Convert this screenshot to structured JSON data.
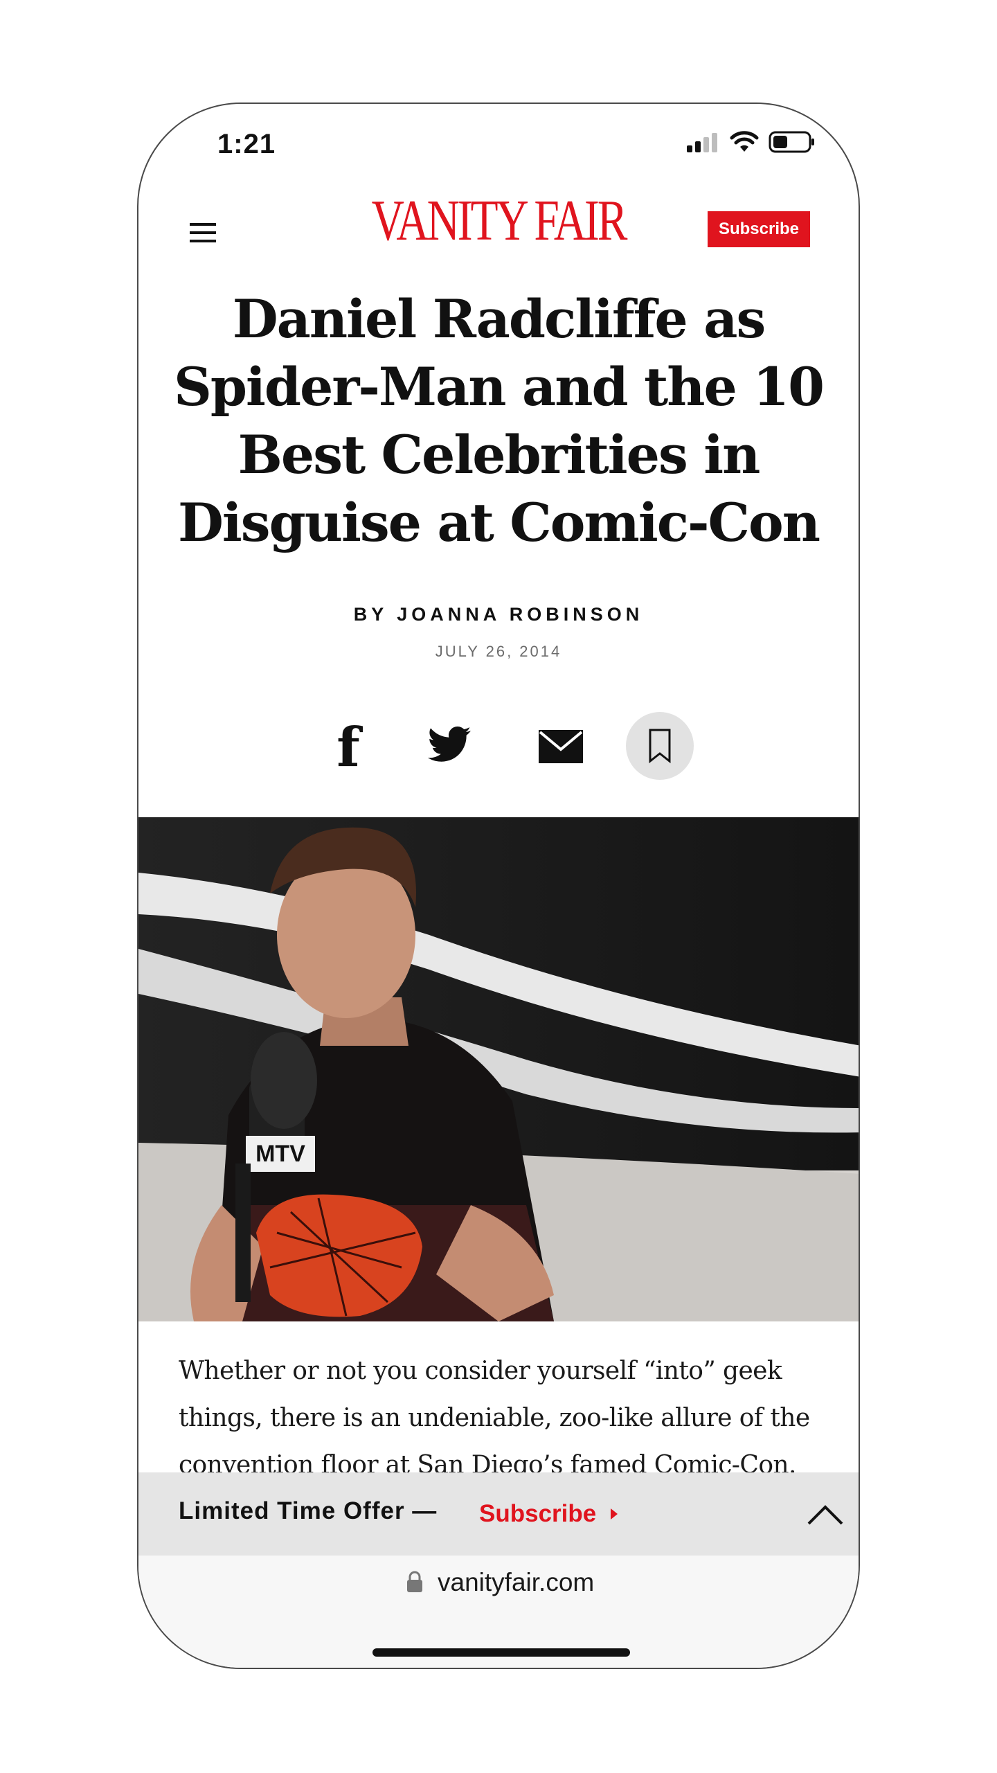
{
  "status_bar": {
    "time": "1:21"
  },
  "header": {
    "logo": "VANITY FAIR",
    "subscribe_label": "Subscribe"
  },
  "article": {
    "headline": "Daniel Radcliffe as Spider-Man and the 10 Best Celebrities in Disguise at Comic-Con",
    "byline": "BY JOANNA ROBINSON",
    "date": "JULY 26, 2014",
    "body": "Whether or not you consider yourself “into” geek things, there is an undeniable, zoo-like allure of the convention floor at San Diego’s famed Comic-Con."
  },
  "share": {
    "facebook_glyph": "f",
    "icons": [
      "facebook-icon",
      "twitter-icon",
      "mail-icon",
      "bookmark-icon"
    ]
  },
  "hero_image": {
    "badge": "MTV"
  },
  "offer_bar": {
    "text": "Limited Time Offer —",
    "link": "Subscribe"
  },
  "browser": {
    "url": "vanityfair.com"
  },
  "colors": {
    "brand_red": "#e0141e",
    "bar_gray": "#e5e5e5"
  }
}
